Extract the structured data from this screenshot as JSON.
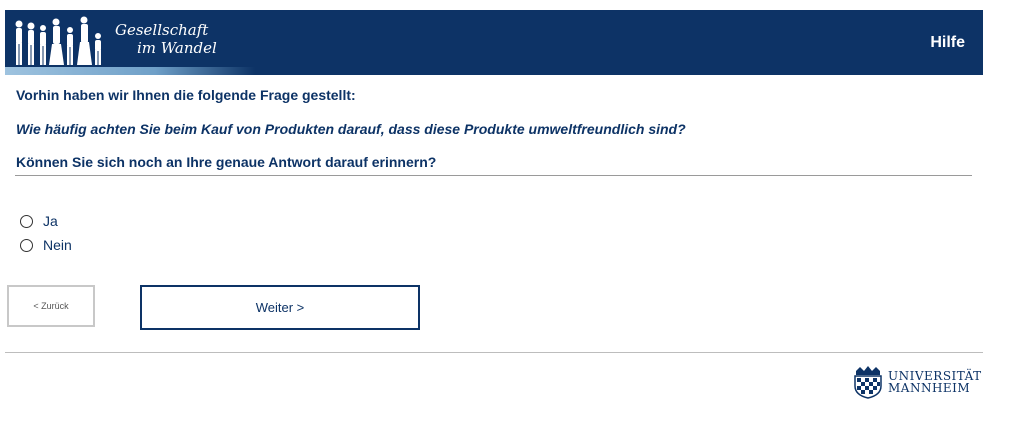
{
  "header": {
    "brand_line1": "Gesellschaft",
    "brand_line2": "im Wandel",
    "help_label": "Hilfe",
    "bg_color": "#0d3366"
  },
  "question": {
    "intro": "Vorhin haben wir Ihnen die folgende Frage gestellt:",
    "quoted": "Wie häufig achten Sie beim Kauf von Produkten darauf, dass diese Produkte umweltfreundlich sind?",
    "ask": "Können Sie sich noch an Ihre genaue Antwort darauf erinnern?"
  },
  "options": [
    {
      "label": "Ja"
    },
    {
      "label": "Nein"
    }
  ],
  "nav": {
    "back_label": "< Zurück",
    "next_label": "Weiter >"
  },
  "footer": {
    "logo_line1": "UNIVERSITÄT",
    "logo_line2": "MANNHEIM"
  }
}
